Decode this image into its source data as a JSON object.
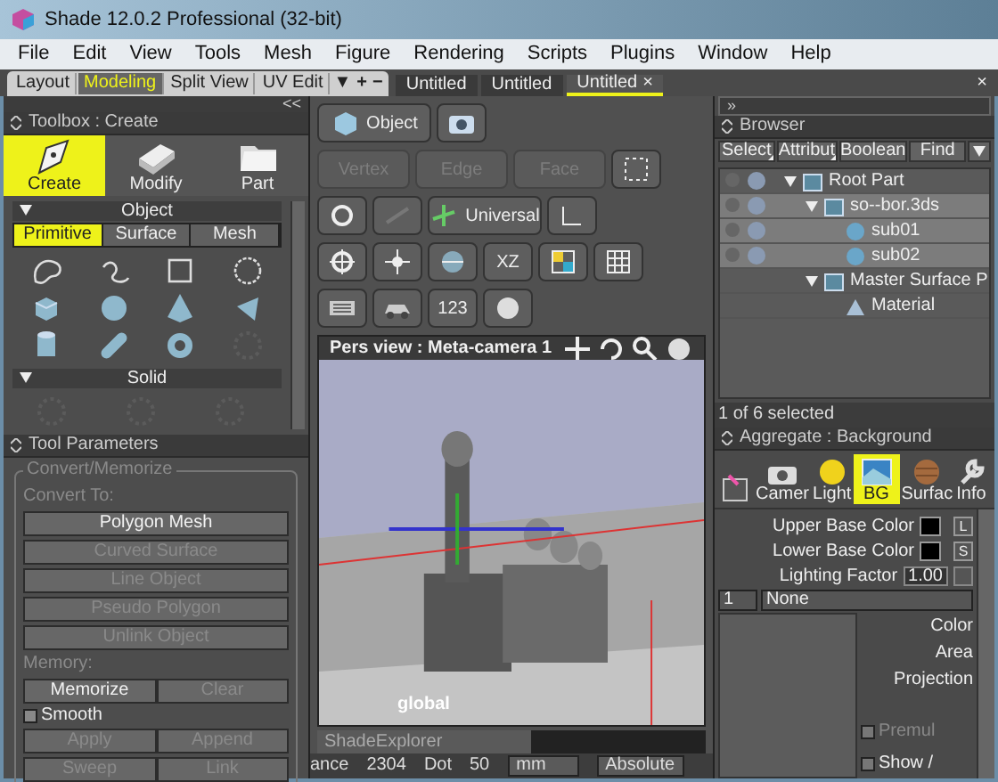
{
  "window": {
    "title": "Shade 12.0.2 Professional (32-bit)"
  },
  "menu": [
    "File",
    "Edit",
    "View",
    "Tools",
    "Mesh",
    "Figure",
    "Rendering",
    "Scripts",
    "Plugins",
    "Window",
    "Help"
  ],
  "layout_tabs": [
    {
      "label": "Layout",
      "selected": false
    },
    {
      "label": "Modeling",
      "selected": true
    },
    {
      "label": "Split View",
      "selected": false
    },
    {
      "label": "UV Edit",
      "selected": false
    }
  ],
  "layout_controls": [
    "▼",
    "+",
    "−"
  ],
  "document_tabs": [
    {
      "label": "Untitled",
      "selected": false
    },
    {
      "label": "Untitled",
      "selected": false
    },
    {
      "label": "Untitled",
      "selected": true
    }
  ],
  "close_tab": "×",
  "close_panel": "×",
  "collapse_left": "<<",
  "collapse_right": "»",
  "toolbox": {
    "title": "Toolbox : Create",
    "modes": [
      {
        "label": "Create",
        "selected": true
      },
      {
        "label": "Modify",
        "selected": false
      },
      {
        "label": "Part",
        "selected": false
      }
    ],
    "object_section": "Object",
    "object_tabs": [
      {
        "label": "Primitive",
        "selected": true
      },
      {
        "label": "Surface",
        "selected": false
      },
      {
        "label": "Mesh",
        "selected": false
      }
    ],
    "solid_section": "Solid"
  },
  "tool_parameters": {
    "title": "Tool Parameters",
    "group": "Convert/Memorize",
    "convert_label": "Convert To:",
    "convert_buttons": [
      {
        "label": "Polygon Mesh",
        "disabled": false
      },
      {
        "label": "Curved Surface",
        "disabled": true
      },
      {
        "label": "Line Object",
        "disabled": true
      },
      {
        "label": "Pseudo Polygon",
        "disabled": true
      },
      {
        "label": "Unlink Object",
        "disabled": true
      }
    ],
    "memory_label": "Memory:",
    "memory_buttons": [
      {
        "label": "Memorize",
        "disabled": false
      },
      {
        "label": "Clear",
        "disabled": true
      }
    ],
    "smooth": {
      "label": "Smooth",
      "checked": false
    },
    "apply_buttons": [
      {
        "label": "Apply",
        "disabled": true
      },
      {
        "label": "Append",
        "disabled": true
      },
      {
        "label": "Sweep",
        "disabled": true
      },
      {
        "label": "Link",
        "disabled": true
      }
    ]
  },
  "toolbar": {
    "object": "Object",
    "selection_modes": [
      {
        "label": "Vertex",
        "disabled": true
      },
      {
        "label": "Edge",
        "disabled": true
      },
      {
        "label": "Face",
        "disabled": true
      }
    ],
    "coordinates": "Universal",
    "plane": "XZ",
    "numeric": "123"
  },
  "viewport": {
    "title": "Pers view : Meta-camera 1",
    "space": "global"
  },
  "explorer": "ShadeExplorer",
  "status": [
    {
      "kind": "text",
      "label": "ance"
    },
    {
      "kind": "text",
      "label": "2304"
    },
    {
      "kind": "text",
      "label": "Dot"
    },
    {
      "kind": "text",
      "label": "50"
    },
    {
      "kind": "dropdown",
      "label": "mm"
    },
    {
      "kind": "dropdown",
      "label": "Absolute"
    }
  ],
  "browser": {
    "title": "Browser",
    "buttons": [
      {
        "label": "Select",
        "menu": true
      },
      {
        "label": "Attribut",
        "menu": true
      },
      {
        "label": "Boolean",
        "menu": false
      },
      {
        "label": "Find",
        "menu": false
      }
    ],
    "tree": [
      {
        "label": "Root Part",
        "kind": "part",
        "selected": false,
        "toggles": true,
        "expanded": true,
        "children": [
          {
            "label": "so--bor.3ds",
            "kind": "part",
            "selected": true,
            "toggles": true,
            "expanded": true,
            "children": [
              {
                "label": "sub01",
                "kind": "mesh",
                "selected": true,
                "toggles": true
              },
              {
                "label": "sub02",
                "kind": "mesh",
                "selected": true,
                "toggles": true
              }
            ]
          },
          {
            "label": "Master Surface P",
            "kind": "part",
            "selected": false,
            "toggles": false,
            "expanded": true,
            "children": [
              {
                "label": "Material",
                "kind": "material",
                "selected": false,
                "toggles": false
              }
            ]
          }
        ]
      }
    ],
    "status": "1 of 6 selected"
  },
  "aggregate": {
    "title": "Aggregate : Background",
    "tabs": [
      {
        "kind": "shape",
        "selected": false
      },
      {
        "kind": "camera",
        "label": "Camer",
        "selected": false
      },
      {
        "kind": "light",
        "label": "Light",
        "selected": false
      },
      {
        "kind": "background",
        "label": "BG",
        "selected": true
      },
      {
        "kind": "surface",
        "label": "Surfac",
        "selected": false
      },
      {
        "kind": "info",
        "label": "Info",
        "selected": false
      }
    ],
    "upper": {
      "label": "Upper Base Color",
      "color": "#000000",
      "button": "L"
    },
    "lower": {
      "label": "Lower Base Color",
      "color": "#000000",
      "button": "S"
    },
    "lighting": {
      "label": "Lighting Factor",
      "value": "1.00"
    },
    "layer": "1",
    "mapping": "None",
    "side_labels": [
      "Color",
      "Area",
      "Projection"
    ],
    "options": [
      {
        "label": "Premul",
        "checked": false,
        "disabled": true
      },
      {
        "label": "Show /",
        "checked": false,
        "disabled": false
      }
    ]
  }
}
